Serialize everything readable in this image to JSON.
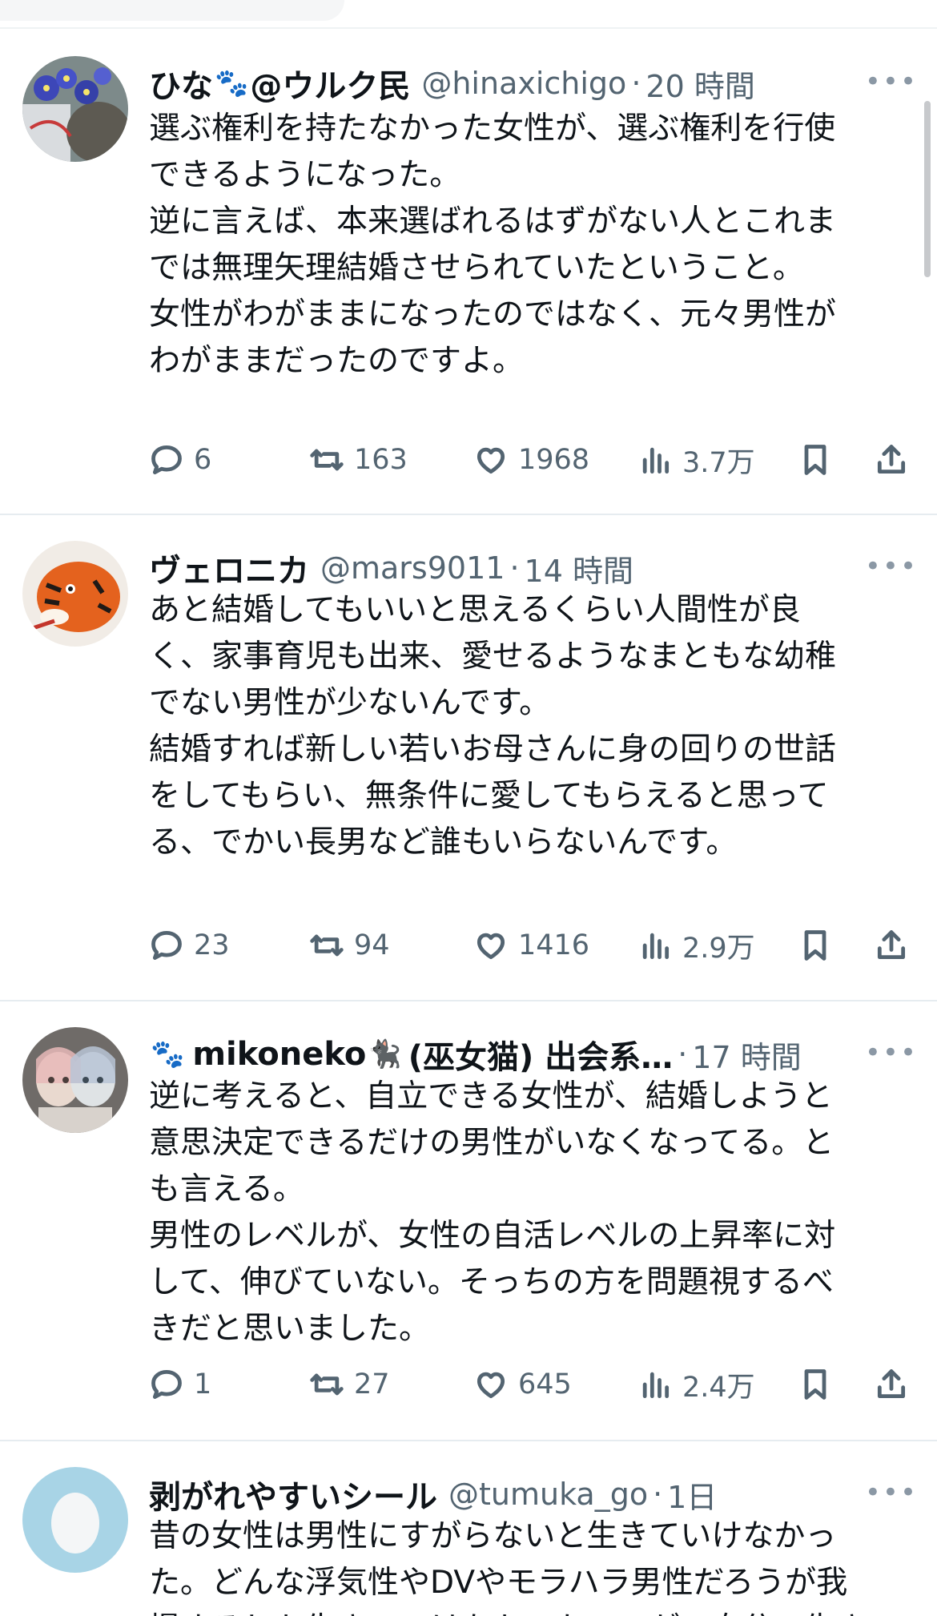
{
  "tweets": [
    {
      "name": "ひな",
      "name_suffix": "@ウルク民",
      "handle": "@hinaxichigo",
      "time": "20 時間",
      "lines": [
        "選ぶ権利を持たなかった女性が、選ぶ権利を行使",
        "できるようになった。",
        "逆に言えば、本来選ばれるはずがない人とこれま",
        "では無理矢理結婚させられていたということ。",
        "",
        "女性がわがままになったのではなく、元々男性が",
        "わがままだったのですよ。"
      ],
      "replies": "6",
      "retweets": "163",
      "likes": "1968",
      "views": "3.7万"
    },
    {
      "name": "ヴェロニカ",
      "name_suffix": "",
      "handle": "@mars9011",
      "time": "14 時間",
      "lines": [
        "あと結婚してもいいと思えるくらい人間性が良",
        "く、家事育児も出来、愛せるようなまともな幼稚",
        "でない男性が少ないんです。",
        "",
        "結婚すれば新しい若いお母さんに身の回りの世話",
        "をしてもらい、無条件に愛してもらえると思って",
        "る、でかい長男など誰もいらないんです。"
      ],
      "replies": "23",
      "retweets": "94",
      "likes": "1416",
      "views": "2.9万"
    },
    {
      "name": "mikoneko",
      "name_suffix": "(巫女猫) 出会系…",
      "handle": "",
      "time": "17 時間",
      "lines": [
        "逆に考えると、自立できる女性が、結婚しようと",
        "意思決定できるだけの男性がいなくなってる。と",
        "も言える。",
        "男性のレベルが、女性の自活レベルの上昇率に対",
        "して、伸びていない。そっちの方を問題視するべ",
        "きだと思いました。"
      ],
      "replies": "1",
      "retweets": "27",
      "likes": "645",
      "views": "2.4万"
    },
    {
      "name": "剥がれやすいシール",
      "name_suffix": "",
      "handle": "@tumuka_go",
      "time": "1日",
      "lines": [
        "昔の女性は男性にすがらないと生きていけなかっ",
        "た。どんな浮気性やDVやモラハラ男性だろうが我",
        "慢するしか生きていけなかった。のが、自分で生き"
      ]
    }
  ],
  "more_label": "•••",
  "separator": "·",
  "icons": {
    "reply": "speech-bubble-icon",
    "retweet": "retweet-arrows-icon",
    "like": "heart-icon",
    "views": "bar-chart-icon",
    "bookmark": "bookmark-icon",
    "share": "share-upload-icon"
  },
  "colors": {
    "text": "#0f1419",
    "secondary": "#536471",
    "divider": "#e6ecf0"
  }
}
